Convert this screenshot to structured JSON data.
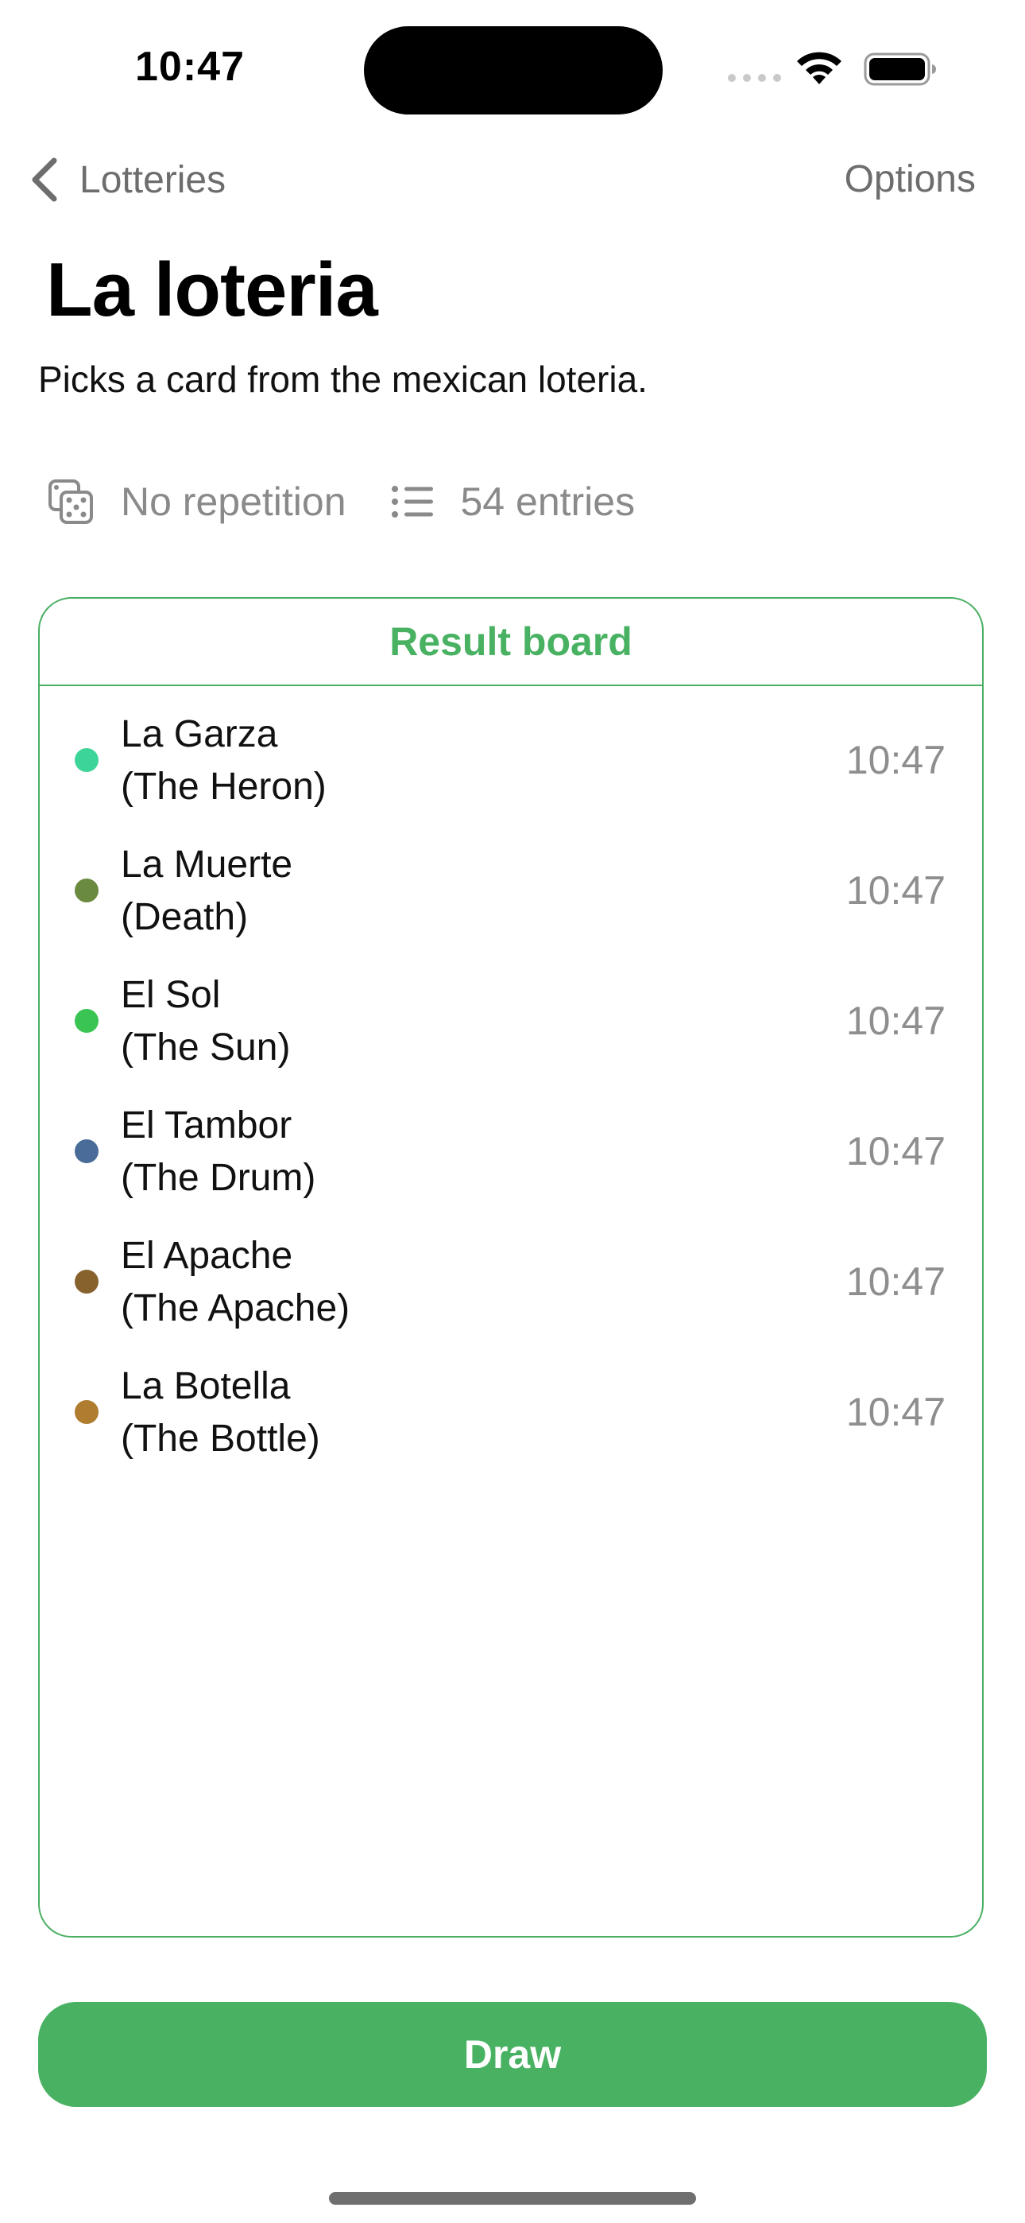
{
  "status_bar": {
    "time": "10:47"
  },
  "nav": {
    "back_label": "Lotteries",
    "options_label": "Options"
  },
  "page": {
    "title": "La loteria",
    "description": "Picks a card from the mexican loteria."
  },
  "meta": {
    "repetition_label": "No repetition",
    "entries_label": "54 entries"
  },
  "board": {
    "header": "Result board",
    "results": [
      {
        "name": "La Garza\n(The Heron)",
        "time": "10:47",
        "color": "#3dd597"
      },
      {
        "name": "La Muerte\n(Death)",
        "time": "10:47",
        "color": "#6a8a3f"
      },
      {
        "name": "El Sol\n(The Sun)",
        "time": "10:47",
        "color": "#39c454"
      },
      {
        "name": "El Tambor\n(The Drum)",
        "time": "10:47",
        "color": "#4a6c99"
      },
      {
        "name": "El Apache\n(The Apache)",
        "time": "10:47",
        "color": "#87622d"
      },
      {
        "name": "La Botella\n(The Bottle)",
        "time": "10:47",
        "color": "#b07c30"
      }
    ]
  },
  "actions": {
    "draw_label": "Draw"
  },
  "colors": {
    "accent": "#49b162",
    "secondary_text": "#8e8e8e"
  }
}
